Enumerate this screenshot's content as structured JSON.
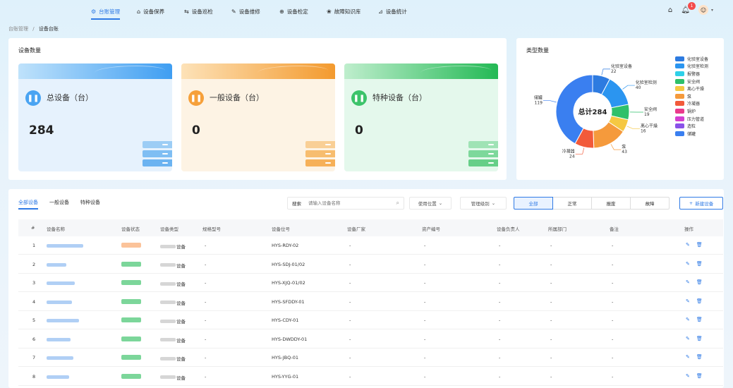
{
  "nav": {
    "items": [
      {
        "label": "台账管理",
        "icon": "⚙",
        "icon_name": "settings-icon",
        "active": true
      },
      {
        "label": "设备保养",
        "icon": "⌂",
        "icon_name": "maintenance-icon",
        "active": false
      },
      {
        "label": "设备巡检",
        "icon": "⇆",
        "icon_name": "inspection-icon",
        "active": false
      },
      {
        "label": "设备维修",
        "icon": "✎",
        "icon_name": "repair-icon",
        "active": false
      },
      {
        "label": "设备检定",
        "icon": "⊕",
        "icon_name": "calibration-icon",
        "active": false
      },
      {
        "label": "故障知识库",
        "icon": "❀",
        "icon_name": "knowledge-icon",
        "active": false
      },
      {
        "label": "设备统计",
        "icon": "⊿",
        "icon_name": "statistics-icon",
        "active": false
      }
    ],
    "notification_count": "1"
  },
  "breadcrumb": {
    "parent": "台账管理",
    "separator": "/",
    "current": "设备台账"
  },
  "stats": {
    "title": "设备数量",
    "cards": [
      {
        "label": "总设备（台）",
        "value": "284"
      },
      {
        "label": "一般设备（台）",
        "value": "0"
      },
      {
        "label": "特种设备（台）",
        "value": "0"
      }
    ]
  },
  "colors": {
    "accent": "#2f7ae5",
    "card_blue": "#5aa7f2",
    "card_orange": "#f6a03a",
    "card_green": "#3cc36a"
  },
  "chart_data": {
    "type": "pie",
    "title": "类型数量",
    "center_label": "总计284",
    "legend_position": "right",
    "slices": [
      {
        "name": "化验室设备",
        "value": 22,
        "color": "#2d7be0"
      },
      {
        "name": "化验室检测",
        "value": 40,
        "color": "#2b95f0"
      },
      {
        "name": "报警器",
        "value": 0,
        "color": "#2ed0e8"
      },
      {
        "name": "安全阀",
        "value": 19,
        "color": "#2fc06a"
      },
      {
        "name": "离心干燥",
        "value": 16,
        "color": "#f5c842"
      },
      {
        "name": "泵",
        "value": 43,
        "color": "#f59a3c"
      },
      {
        "name": "冷凝器",
        "value": 24,
        "color": "#f25a3a"
      },
      {
        "name": "锅炉",
        "value": 0,
        "color": "#ea3a8c"
      },
      {
        "name": "压力管道",
        "value": 0,
        "color": "#d43fd0"
      },
      {
        "name": "造粒",
        "value": 0,
        "color": "#8a52e8"
      },
      {
        "name": "储罐",
        "value": 119,
        "color": "#3a7ff0"
      }
    ]
  },
  "toolbar": {
    "tabs": [
      "全部设备",
      "一般设备",
      "特种设备"
    ],
    "search_label": "搜索",
    "search_placeholder": "请输入设备名称",
    "filter_location": "使用位置",
    "filter_level": "管理级别",
    "status_filters": [
      "全部",
      "正常",
      "报废",
      "故障"
    ],
    "new_button": "新建设备"
  },
  "table": {
    "headers": [
      "#",
      "设备名称",
      "设备状态",
      "设备类型",
      "规格型号",
      "设备位号",
      "设备厂家",
      "资产编号",
      "设备负责人",
      "所属部门",
      "备注",
      "操作"
    ],
    "rows": [
      {
        "index": "1",
        "status": "warn",
        "type_suffix": "设备",
        "spec": "-",
        "tag": "HYS-RDY-02",
        "vendor": "-",
        "asset": "-",
        "owner": "-",
        "dept": "-",
        "note": "-"
      },
      {
        "index": "2",
        "status": "ok",
        "type_suffix": "设备",
        "spec": "-",
        "tag": "HYS-SDJ-01/02",
        "vendor": "-",
        "asset": "-",
        "owner": "-",
        "dept": "-",
        "note": "-"
      },
      {
        "index": "3",
        "status": "ok",
        "type_suffix": "设备",
        "spec": "-",
        "tag": "HYS-XJQ-01/02",
        "vendor": "-",
        "asset": "-",
        "owner": "-",
        "dept": "-",
        "note": "-"
      },
      {
        "index": "4",
        "status": "ok",
        "type_suffix": "设备",
        "spec": "-",
        "tag": "HYS-SFDDY-01",
        "vendor": "-",
        "asset": "-",
        "owner": "-",
        "dept": "-",
        "note": "-"
      },
      {
        "index": "5",
        "status": "ok",
        "type_suffix": "设备",
        "spec": "-",
        "tag": "HYS-CDY-01",
        "vendor": "-",
        "asset": "-",
        "owner": "-",
        "dept": "-",
        "note": "-"
      },
      {
        "index": "6",
        "status": "ok",
        "type_suffix": "设备",
        "spec": "-",
        "tag": "HYS-DWDDY-01",
        "vendor": "-",
        "asset": "-",
        "owner": "-",
        "dept": "-",
        "note": "-"
      },
      {
        "index": "7",
        "status": "ok",
        "type_suffix": "设备",
        "spec": "-",
        "tag": "HYS-JBQ-01",
        "vendor": "-",
        "asset": "-",
        "owner": "-",
        "dept": "-",
        "note": "-"
      },
      {
        "index": "8",
        "status": "ok",
        "type_suffix": "设备",
        "spec": "-",
        "tag": "HYS-YYG-01",
        "vendor": "-",
        "asset": "-",
        "owner": "-",
        "dept": "-",
        "note": "-"
      }
    ]
  }
}
